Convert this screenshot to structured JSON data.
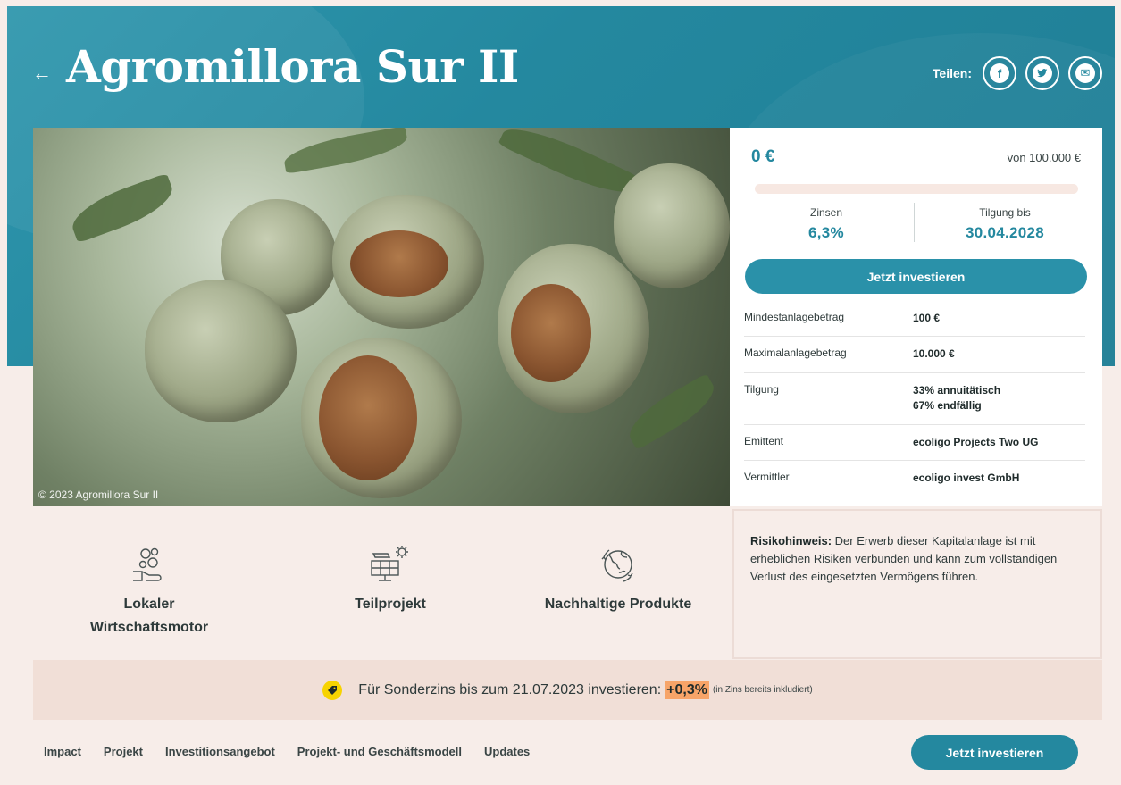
{
  "header": {
    "title": "Agromillora Sur II",
    "back_icon": "arrow-left-icon",
    "share_label": "Teilen:",
    "share": [
      {
        "icon": "facebook-icon",
        "glyph": "f"
      },
      {
        "icon": "twitter-icon",
        "glyph": "t"
      },
      {
        "icon": "mail-icon",
        "glyph": "✉"
      }
    ]
  },
  "photo": {
    "credit": "© 2023 Agromillora Sur II"
  },
  "funding": {
    "amount": "0 €",
    "goal": "von 100.000 €",
    "progress": 0,
    "interest_label": "Zinsen",
    "interest_value": "6,3%",
    "repayment_label": "Tilgung bis",
    "repayment_value": "30.04.2028",
    "invest_button": "Jetzt investieren"
  },
  "details": [
    {
      "key": "Mindestanlagebetrag",
      "value": "100 €"
    },
    {
      "key": "Maximalanlagebetrag",
      "value": "10.000 €"
    },
    {
      "key": "Tilgung",
      "value": "33% annuitätisch",
      "value2": "67% endfällig"
    },
    {
      "key": "Emittent",
      "value": "ecoligo Projects Two UG"
    },
    {
      "key": "Vermittler",
      "value": "ecoligo invest GmbH"
    }
  ],
  "features": [
    {
      "icon": "hand-gears-icon",
      "line1": "Lokaler",
      "line2": "Wirtschaftsmotor"
    },
    {
      "icon": "solar-panel-icon",
      "line1": "Teilprojekt",
      "line2": ""
    },
    {
      "icon": "globe-leaf-icon",
      "line1": "Nachhaltige Produkte",
      "line2": ""
    }
  ],
  "risk": {
    "label": "Risikohinweis:",
    "text": " Der Erwerb dieser Kapitalanlage ist mit erheblichen Risiken verbunden und kann zum vollständigen Verlust des eingesetzten Vermögens führen."
  },
  "promo": {
    "icon": "tag-icon",
    "text": "Für Sonderzins bis zum 21.07.2023 investieren:",
    "highlight": "+0,3%",
    "note": "(in Zins bereits inkludiert)"
  },
  "bottom_nav": {
    "items": [
      "Impact",
      "Projekt",
      "Investitionsangebot",
      "Projekt- und Geschäftsmodell",
      "Updates"
    ],
    "button": "Jetzt investieren"
  },
  "colors": {
    "teal": "#24889f",
    "background": "#f7ede9",
    "promo_bg": "#f1dfd7",
    "highlight": "#f7a468",
    "tag": "#f7d300"
  }
}
